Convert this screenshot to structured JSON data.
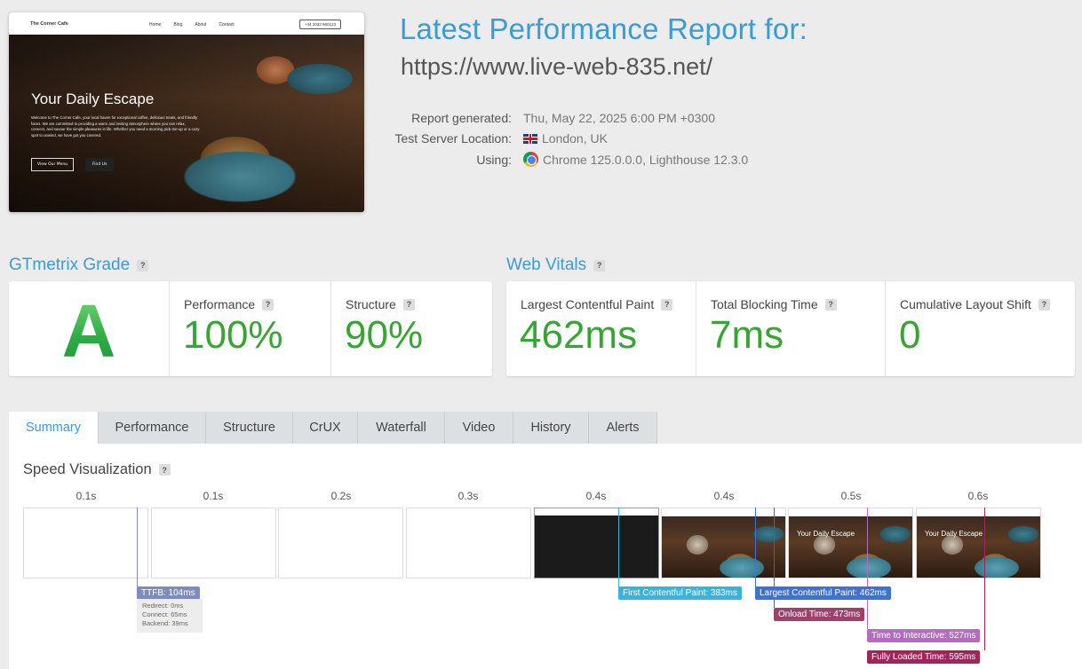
{
  "thumbnail": {
    "brand": "The Corner Cafe",
    "nav_links": [
      "Home",
      "Blog",
      "About",
      "Contact"
    ],
    "phone": "+44 2032 960123",
    "hero_title": "Your Daily Escape",
    "hero_text": "Welcome to The Corner Cafe, your local haven for exceptional coffee, delicious treats, and friendly faces. We are committed to providing a warm and inviting atmosphere where you can relax, connect, and savour the simple pleasures in life. Whether you need a morning pick-me-up or a cozy spot to unwind, we have got you covered.",
    "btn_primary": "View Our Menu",
    "btn_secondary": "Find Us"
  },
  "header": {
    "title": "Latest Performance Report for:",
    "url": "https://www.live-web-835.net/",
    "meta": [
      {
        "label": "Report generated:",
        "value": "Thu, May 22, 2025 6:00 PM +0300",
        "icon": ""
      },
      {
        "label": "Test Server Location:",
        "value": "London, UK",
        "icon": "uk-flag-icon"
      },
      {
        "label": "Using:",
        "value": "Chrome 125.0.0.0, Lighthouse 12.3.0",
        "icon": "chrome-icon"
      }
    ]
  },
  "grade": {
    "heading": "GTmetrix Grade",
    "letter": "A",
    "performance_label": "Performance",
    "performance_value": "100%",
    "structure_label": "Structure",
    "structure_value": "90%"
  },
  "vitals": {
    "heading": "Web Vitals",
    "lcp_label": "Largest Contentful Paint",
    "lcp_value": "462ms",
    "tbt_label": "Total Blocking Time",
    "tbt_value": "7ms",
    "cls_label": "Cumulative Layout Shift",
    "cls_value": "0"
  },
  "help_glyph": "?",
  "tabs": [
    "Summary",
    "Performance",
    "Structure",
    "CrUX",
    "Waterfall",
    "Video",
    "History",
    "Alerts"
  ],
  "active_tab": "Summary",
  "speed": {
    "title": "Speed Visualization",
    "frame_times": [
      "0.1s",
      "0.1s",
      "0.2s",
      "0.3s",
      "0.4s",
      "0.4s",
      "0.5s",
      "0.6s"
    ],
    "frame_title": "Your Daily Escape",
    "ttfb": {
      "label": "TTFB: 104ms",
      "redirect": "Redirect: 0ms",
      "connect": "Connect: 65ms",
      "backend": "Backend: 39ms"
    },
    "markers": {
      "fcp": "First Contentful Paint: 383ms",
      "lcp": "Largest Contentful Paint: 462ms",
      "onload": "Onload Time: 473ms",
      "tti": "Time to Interactive: 527ms",
      "fully": "Fully Loaded Time: 595ms"
    }
  },
  "colors": {
    "accent": "#3a9bd5",
    "grade_green": "#36a532",
    "ttfb": "#7d8bbf",
    "fcp": "#39b3de",
    "lcp": "#3d72cf",
    "onload": "#a0406a",
    "tti": "#b46bc1",
    "fully": "#a3245a"
  }
}
